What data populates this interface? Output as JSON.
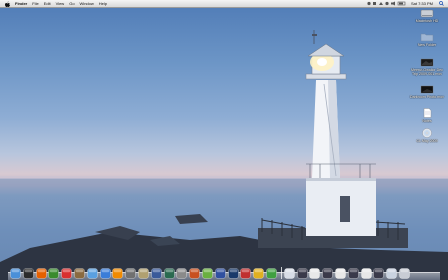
{
  "menubar": {
    "apple_icon": "apple-icon",
    "menus": [
      "Finder",
      "File",
      "Edit",
      "View",
      "Go",
      "Window",
      "Help"
    ],
    "clock": "Sat 7:33 PM"
  },
  "desktop": {
    "icons": [
      {
        "label": "Macintosh HD",
        "icon": "hard-drive-icon"
      },
      {
        "label": "New Folder",
        "icon": "folder-icon"
      },
      {
        "label": "Meerut-Gwalior Dec Trip 2009-001.mov",
        "icon": "movie-file-icon"
      },
      {
        "label": "Darkroom Photo.mov",
        "icon": "movie-file-icon"
      },
      {
        "label": "Notes",
        "icon": "document-icon"
      },
      {
        "label": "CL May 2009",
        "icon": "disc-icon"
      }
    ]
  },
  "colors": {
    "sky_top": "#4f7bb6",
    "horizon": "#d7c9d2",
    "sea": "#6f8fba",
    "lighthouse": "#f2f4f8",
    "light_glow": "#fff3c4"
  },
  "dock": {
    "apps": [
      {
        "name": "finder-icon",
        "color": "#4a90d9"
      },
      {
        "name": "dashboard-icon",
        "color": "#2b2b2b"
      },
      {
        "name": "firefox-icon",
        "color": "#e66000"
      },
      {
        "name": "adium-icon",
        "color": "#3a8b2e"
      },
      {
        "name": "calendar-icon",
        "color": "#d93030"
      },
      {
        "name": "address-book-icon",
        "color": "#8a6a40"
      },
      {
        "name": "itunes-icon",
        "color": "#5aa0e0"
      },
      {
        "name": "safari-icon",
        "color": "#3b7dd8"
      },
      {
        "name": "vlc-icon",
        "color": "#f08a00"
      },
      {
        "name": "utility-icon",
        "color": "#707070"
      },
      {
        "name": "preview-icon",
        "color": "#b0a070"
      },
      {
        "name": "quicktime-icon",
        "color": "#3a5a9a"
      },
      {
        "name": "time-machine-icon",
        "color": "#2a6a50"
      },
      {
        "name": "system-preferences-icon",
        "color": "#8a8a8a"
      },
      {
        "name": "tool-icon",
        "color": "#c85020"
      },
      {
        "name": "coda-icon",
        "color": "#6ab040"
      },
      {
        "name": "game-icon",
        "color": "#3050a0"
      },
      {
        "name": "photoshop-icon",
        "color": "#1a3a6a"
      },
      {
        "name": "app-red-icon",
        "color": "#c03030"
      },
      {
        "name": "app-yellow-icon",
        "color": "#e0b020"
      },
      {
        "name": "app-green-icon",
        "color": "#40a040"
      }
    ],
    "docs": [
      {
        "name": "stack-folder-icon",
        "color": "#d8dde6"
      },
      {
        "name": "window-thumbnail-icon",
        "color": "#3a3a4a"
      },
      {
        "name": "window-thumbnail-icon",
        "color": "#e8e8e8"
      },
      {
        "name": "window-thumbnail-icon",
        "color": "#3a3a4a"
      },
      {
        "name": "window-thumbnail-icon",
        "color": "#e8e8e8"
      },
      {
        "name": "window-thumbnail-icon",
        "color": "#3a3a4a"
      },
      {
        "name": "window-thumbnail-icon",
        "color": "#e8e8e8"
      },
      {
        "name": "window-thumbnail-icon",
        "color": "#3a3a4a"
      },
      {
        "name": "documents-stack-icon",
        "color": "#c9d2e0"
      },
      {
        "name": "trash-icon",
        "color": "#c8ccd4"
      }
    ]
  }
}
